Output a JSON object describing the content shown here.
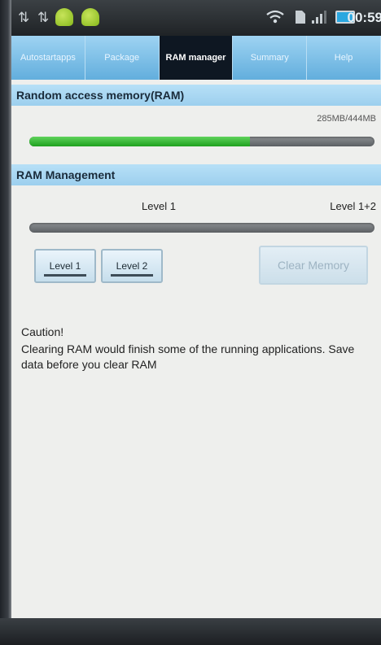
{
  "status_bar": {
    "time": "00:59",
    "icons": [
      "usb-icon",
      "usb-icon",
      "android-icon",
      "android-icon",
      "wifi-icon",
      "sim-icon",
      "signal-icon",
      "battery-icon"
    ]
  },
  "tabs": [
    {
      "label": "Autostartapps",
      "active": false
    },
    {
      "label": "Package",
      "active": false
    },
    {
      "label": "RAM manager",
      "active": true
    },
    {
      "label": "Summary",
      "active": false
    },
    {
      "label": "Help",
      "active": false
    }
  ],
  "ram_section": {
    "header": "Random access memory(RAM)",
    "value_label": "285MB/444MB",
    "used_fraction": 0.64
  },
  "management_section": {
    "header": "RAM Management",
    "level1_label": "Level 1",
    "level12_label": "Level 1+2",
    "level_button1": "Level 1",
    "level_button2": "Level 2",
    "clear_button": "Clear Memory",
    "caution": "Caution!",
    "message": "Clearing RAM would finish some of the running applications. Save data before you clear RAM"
  },
  "colors": {
    "accent": "#7dbfe6",
    "progress": "#2fb52f",
    "active_tab": "#0e1722"
  }
}
